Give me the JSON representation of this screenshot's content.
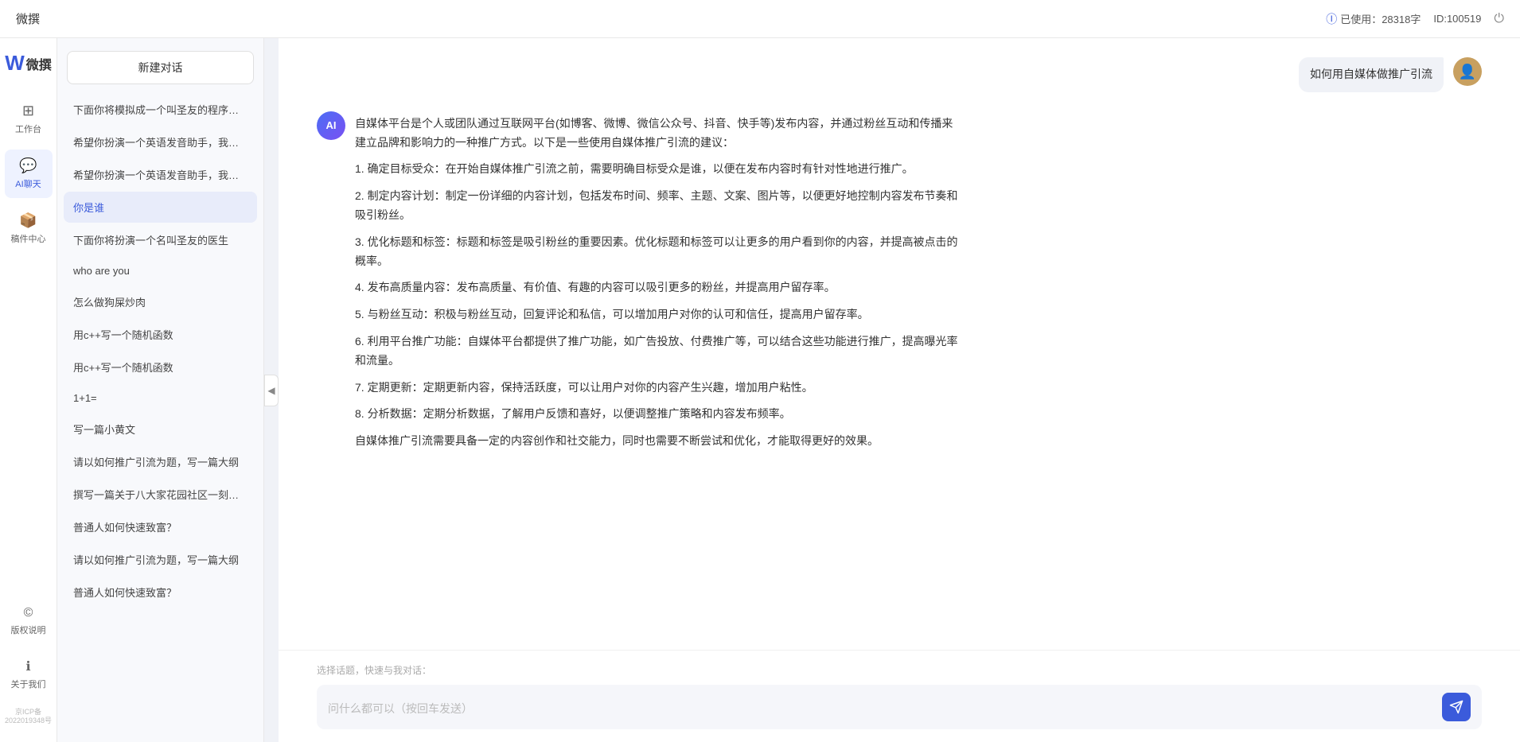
{
  "header": {
    "title": "微撰",
    "usage_label": "已使用：28318字",
    "id_label": "ID:100519",
    "usage_icon": "ℹ"
  },
  "logo": {
    "w": "W",
    "name": "微撰"
  },
  "nav": {
    "items": [
      {
        "id": "workbench",
        "icon": "⊞",
        "label": "工作台"
      },
      {
        "id": "ai-chat",
        "icon": "💬",
        "label": "AI聊天"
      },
      {
        "id": "mailbox",
        "icon": "📦",
        "label": "稿件中心"
      }
    ],
    "bottom_items": [
      {
        "id": "copyright",
        "icon": "©",
        "label": "版权说明"
      },
      {
        "id": "about",
        "icon": "ℹ",
        "label": "关于我们"
      }
    ],
    "icp": "京ICP备2022019348号"
  },
  "sidebar": {
    "new_chat": "新建对话",
    "chat_items": [
      {
        "id": 1,
        "label": "下面你将模拟成一个叫圣友的程序员，我说..."
      },
      {
        "id": 2,
        "label": "希望你扮演一个英语发音助手，我提供给你..."
      },
      {
        "id": 3,
        "label": "希望你扮演一个英语发音助手，我提供给你..."
      },
      {
        "id": 4,
        "label": "你是谁",
        "active": true
      },
      {
        "id": 5,
        "label": "下面你将扮演一个名叫圣友的医生"
      },
      {
        "id": 6,
        "label": "who are you"
      },
      {
        "id": 7,
        "label": "怎么做狗屎炒肉"
      },
      {
        "id": 8,
        "label": "用c++写一个随机函数"
      },
      {
        "id": 9,
        "label": "用c++写一个随机函数"
      },
      {
        "id": 10,
        "label": "1+1="
      },
      {
        "id": 11,
        "label": "写一篇小黄文"
      },
      {
        "id": 12,
        "label": "请以如何推广引流为题，写一篇大纲"
      },
      {
        "id": 13,
        "label": "撰写一篇关于八大家花园社区一刻钟便民生..."
      },
      {
        "id": 14,
        "label": "普通人如何快速致富？"
      },
      {
        "id": 15,
        "label": "请以如何推广引流为题，写一篇大纲"
      },
      {
        "id": 16,
        "label": "普通人如何快速致富？"
      }
    ]
  },
  "chat": {
    "user_question": "如何用自媒体做推广引流",
    "ai_response": {
      "paragraph1": "自媒体平台是个人或团队通过互联网平台(如博客、微博、微信公众号、抖音、快手等)发布内容，并通过粉丝互动和传播来建立品牌和影响力的一种推广方式。以下是一些使用自媒体推广引流的建议：",
      "items": [
        "1. 确定目标受众：在开始自媒体推广引流之前，需要明确目标受众是谁，以便在发布内容时有针对性地进行推广。",
        "2. 制定内容计划：制定一份详细的内容计划，包括发布时间、频率、主题、文案、图片等，以便更好地控制内容发布节奏和吸引粉丝。",
        "3. 优化标题和标签：标题和标签是吸引粉丝的重要因素。优化标题和标签可以让更多的用户看到你的内容，并提高被点击的概率。",
        "4. 发布高质量内容：发布高质量、有价值、有趣的内容可以吸引更多的粉丝，并提高用户留存率。",
        "5. 与粉丝互动：积极与粉丝互动，回复评论和私信，可以增加用户对你的认可和信任，提高用户留存率。",
        "6. 利用平台推广功能：自媒体平台都提供了推广功能，如广告投放、付费推广等，可以结合这些功能进行推广，提高曝光率和流量。",
        "7. 定期更新：定期更新内容，保持活跃度，可以让用户对你的内容产生兴趣，增加用户粘性。",
        "8. 分析数据：定期分析数据，了解用户反馈和喜好，以便调整推广策略和内容发布频率。"
      ],
      "conclusion": "自媒体推广引流需要具备一定的内容创作和社交能力，同时也需要不断尝试和优化，才能取得更好的效果。"
    },
    "quick_topics_label": "选择话题，快速与我对话：",
    "input_placeholder": "问什么都可以（按回车发送）"
  }
}
